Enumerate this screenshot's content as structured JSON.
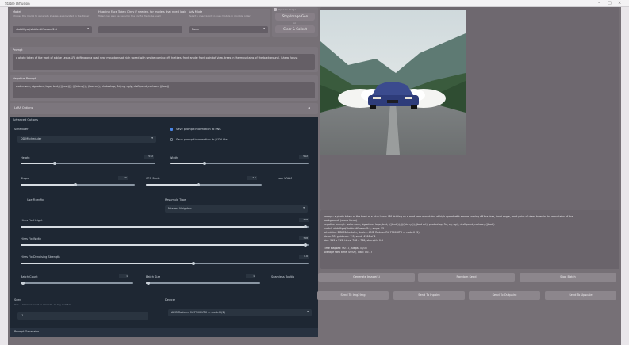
{
  "window": {
    "title": "Stable Diffusion"
  },
  "header": {
    "model": {
      "label": "Model",
      "hint": "Choose the model to generate images, as provided in the folder",
      "value": "stabilityai/stable-diffusion-2-1"
    },
    "hf_token": {
      "label": "Hugging Face Token (Only if needed, for models that need login)",
      "hint": "Token can also be saved in the config file to be used",
      "value": ""
    },
    "adv_mode": {
      "label": "Adv Mode",
      "hint": "Select a checkpoint to use, models in models folder",
      "value": "None"
    },
    "upscale_toggle": {
      "label": "Upscale Image"
    },
    "stop_button": {
      "label": "Stop Image Gen"
    },
    "clear_button": {
      "label": "Clear & Collect"
    },
    "or_label": "or"
  },
  "prompt": {
    "label": "Prompt",
    "value": "a photo taken of the front of a blue Lexus LFA drifting on a road near mountains at high speed with smoke coming off the tires, front angle, front point of view, trees in the mountains of the background, (sharp focus)"
  },
  "negative_prompt": {
    "label": "Negative Prompt",
    "value": "watermark, signature, logo, text, (((text))), (((blurry))), (bad art), photoshop, 3d, cg, ugly, disfigured, cartoon, ((bad))"
  },
  "lora_options": {
    "label": "LoRA Options",
    "toggle": "◄"
  },
  "advanced": {
    "title": "Advanced Options",
    "scheduler": {
      "label": "Scheduler",
      "value": "DDIMScheduler"
    },
    "save_png": {
      "label": "Save prompt information to PNG"
    },
    "save_file": {
      "label": "Save prompt information to JSON file"
    },
    "height": {
      "label": "Height",
      "value": "512",
      "fill": 0.25
    },
    "width": {
      "label": "Width",
      "value": "512",
      "fill": 0.25
    },
    "steps": {
      "label": "Steps",
      "value": "35",
      "fill": 0.48
    },
    "cfg": {
      "label": "CFG Scale",
      "value": "7.5",
      "fill": 0.45
    },
    "low_vram": {
      "label": "Low VRAM"
    },
    "use_fixedfix": {
      "label": "Use Fixedfix"
    },
    "resample_type": {
      "label": "Resample Type",
      "value": "Nearest Neighbor"
    },
    "hires_height": {
      "label": "Hires Fix Height",
      "value": "768",
      "fill": 0.99
    },
    "hires_width": {
      "label": "Hires Fix Width",
      "value": "768",
      "fill": 0.99
    },
    "hires_denoise": {
      "label": "Hires Fix Denoising Strength",
      "value": "0.6",
      "fill": 0.6
    },
    "batch_count": {
      "label": "Batch Count",
      "value": "1",
      "fill": 0.02
    },
    "batch_size": {
      "label": "Batch Size",
      "value": "1",
      "fill": 0.02
    },
    "seamless": {
      "label": "Seamless Tooltip"
    },
    "seed": {
      "label": "Seed",
      "hint": "Use -1 to leave seed as random, or any number",
      "value": "-1"
    },
    "device": {
      "label": "Device",
      "value": "AMD Radeon RX 7900 XTX — cuda:0 (2)"
    }
  },
  "prompt_generator": {
    "label": "Prompt Generator"
  },
  "output": {
    "info_lines": [
      "prompt: a photo taken of the front of a blue Lexus LFA drifting on a road near mountains at high speed with smoke coming off the tires, front angle, front point of view, trees in the mountains of the",
      "background, (sharp focus)",
      "negative prompt: watermark, signature, logo, text, (((text))), (((blurry))), (bad art), photoshop, 3d, cg, ugly, disfigured, cartoon, ((bad))",
      "model: stabilityai/stable-diffusion-2-1, steps: 35",
      "scheduler: DDIMScheduler, device: AMD Radeon RX 7900 XTX — cuda:0 (2)",
      "steps: 35, guidance: 7.5, seed: 4166 of 1",
      "size: 512 x 512, hires: 768 x 768, strength: 0.6",
      "",
      "Time elapsed: 00:17, Steps: 35/35",
      "Average step time: 00:00, Total: 00:17"
    ]
  },
  "buttons_row1": [
    "Generate Image(s)",
    "Random Seed",
    "Stop Batch"
  ],
  "buttons_row2": [
    "Send To Img2Img",
    "Send To Inpaint",
    "Send To Outpaint",
    "Send To Upscale"
  ],
  "colors": {
    "accent": "#4a86e8",
    "panel_dark": "#1e2733",
    "overlay": "#767076"
  }
}
